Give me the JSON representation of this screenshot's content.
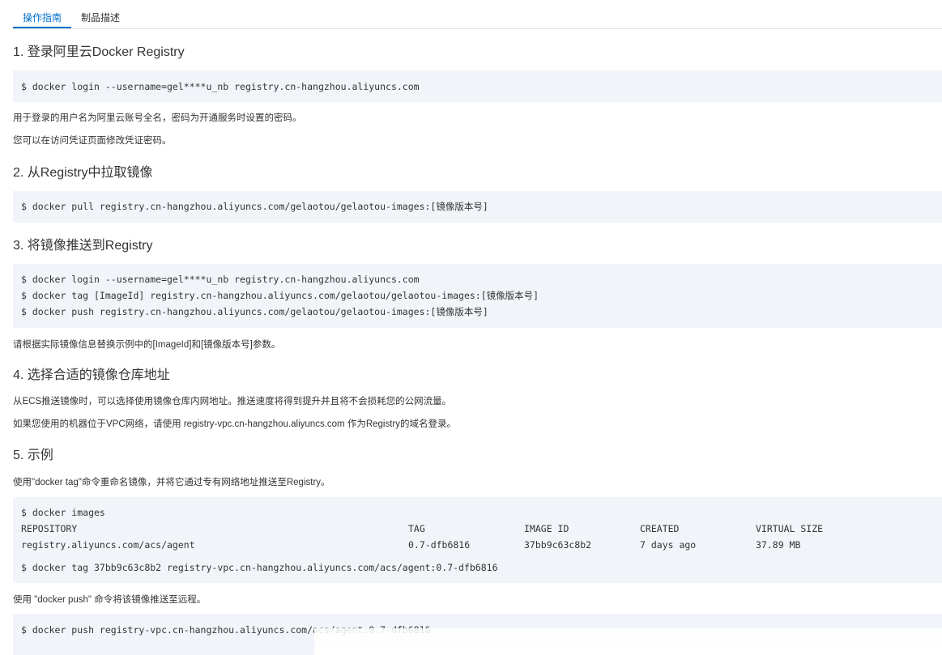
{
  "tabs": [
    {
      "label": "操作指南",
      "active": true
    },
    {
      "label": "制品描述",
      "active": false
    }
  ],
  "sections": {
    "s1": {
      "title": "1. 登录阿里云Docker Registry",
      "code": [
        "$ docker login --username=gel****u_nb registry.cn-hangzhou.aliyuncs.com"
      ],
      "notes": [
        "用于登录的用户名为阿里云账号全名，密码为开通服务时设置的密码。",
        "您可以在访问凭证页面修改凭证密码。"
      ]
    },
    "s2": {
      "title": "2. 从Registry中拉取镜像",
      "code": [
        "$ docker pull registry.cn-hangzhou.aliyuncs.com/gelaotou/gelaotou-images:[镜像版本号]"
      ]
    },
    "s3": {
      "title": "3. 将镜像推送到Registry",
      "code": [
        "$ docker login --username=gel****u_nb registry.cn-hangzhou.aliyuncs.com",
        "$ docker tag [ImageId] registry.cn-hangzhou.aliyuncs.com/gelaotou/gelaotou-images:[镜像版本号]",
        "$ docker push registry.cn-hangzhou.aliyuncs.com/gelaotou/gelaotou-images:[镜像版本号]"
      ],
      "notes": [
        "请根据实际镜像信息替换示例中的[ImageId]和[镜像版本号]参数。"
      ]
    },
    "s4": {
      "title": "4. 选择合适的镜像仓库地址",
      "notes": [
        "从ECS推送镜像时，可以选择使用镜像仓库内网地址。推送速度将得到提升并且将不会损耗您的公网流量。",
        "如果您使用的机器位于VPC网络，请使用 registry-vpc.cn-hangzhou.aliyuncs.com 作为Registry的域名登录。"
      ]
    },
    "s5": {
      "title": "5. 示例",
      "intro": "使用\"docker tag\"命令重命名镜像，并将它通过专有网络地址推送至Registry。",
      "images_cmd": "$ docker images",
      "table": {
        "headers": [
          "REPOSITORY",
          "TAG",
          "IMAGE ID",
          "CREATED",
          "VIRTUAL SIZE"
        ],
        "row": [
          "registry.aliyuncs.com/acs/agent",
          "0.7-dfb6816",
          "37bb9c63c8b2",
          "7 days ago",
          "37.89 MB"
        ]
      },
      "tag_cmd": "$ docker tag 37bb9c63c8b2 registry-vpc.cn-hangzhou.aliyuncs.com/acs/agent:0.7-dfb6816",
      "push_intro": "使用 \"docker push\" 命令将该镜像推送至远程。",
      "push_cmd": "$ docker push registry-vpc.cn-hangzhou.aliyuncs.com/acs/agent:0.7-dfb6816"
    }
  },
  "colors": {
    "accent": "#0070cc",
    "code_bg": "#f1f5fa",
    "text": "#333333"
  }
}
